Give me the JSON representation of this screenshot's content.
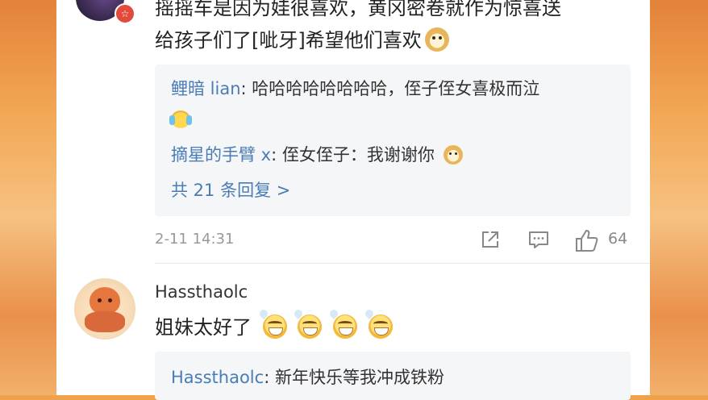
{
  "comment1": {
    "text_line1": "摇摇车是因为娃很喜欢，黄冈密卷就作为惊喜送",
    "text_line2": "给孩子们了[呲牙]希望他们喜欢",
    "emoji": "doge-icon",
    "badge_icon": "vip-badge-icon",
    "replies": [
      {
        "name": "鲤暗 lian",
        "text": "哈哈哈哈哈哈哈哈，侄子侄女喜极而泣",
        "emoji": "crying-laugh-icon"
      },
      {
        "name": "摘星的手臂 x",
        "text": "侄女侄子：我谢谢你",
        "emoji": "doge-icon"
      }
    ],
    "more_replies": "共 21 条回复 >",
    "timestamp": "2-11 14:31",
    "like_count": "64"
  },
  "comment2": {
    "username": "Hassthaolc",
    "text": "姐妹太好了",
    "emoji": "grin-sweat-icon",
    "emoji_count": 4,
    "reply": {
      "name": "Hassthaolc",
      "text": "新年快乐等我冲成铁粉"
    }
  }
}
